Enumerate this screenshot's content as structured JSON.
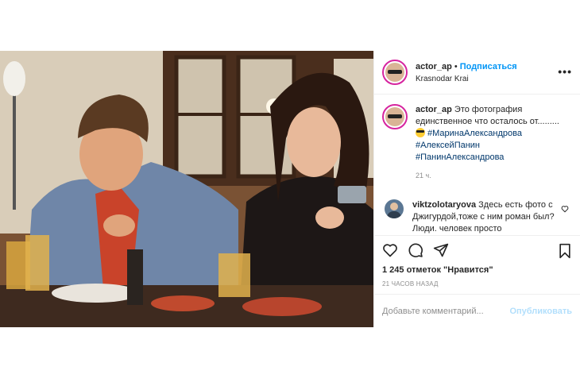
{
  "post": {
    "username": "actor_ap",
    "dot": "•",
    "follow_label": "Подписаться",
    "location": "Krasnodar Krai",
    "more_label": "•••"
  },
  "caption": {
    "username": "actor_ap",
    "text": "Это фотография единственное что осталось от.........",
    "hashtags": [
      "#МаринаАлександрова",
      "#АлексейПанин",
      "#ПанинАлександрова"
    ],
    "time": "21 ч."
  },
  "comment": {
    "username": "viktzolotaryova",
    "text": "Здесь есть фото с Джигурдой,тоже с ним роман был?Люди. человек просто"
  },
  "likes_text": "1 245 отметок \"Нравится\"",
  "time_ago": "21 ЧАСОВ НАЗАД",
  "add_comment": {
    "placeholder": "Добавьте комментарий...",
    "publish_label": "Опубликовать"
  },
  "icons": {
    "like": "heart-icon",
    "comment": "comment-icon",
    "share": "paper-plane-icon",
    "save": "bookmark-icon",
    "options": "more-options-icon",
    "comment_like": "small-heart-icon"
  },
  "colors": {
    "accent_blue": "#0095f6",
    "hashtag": "#00376b",
    "muted": "#8e8e8e",
    "publish_disabled": "#b2dffc"
  }
}
